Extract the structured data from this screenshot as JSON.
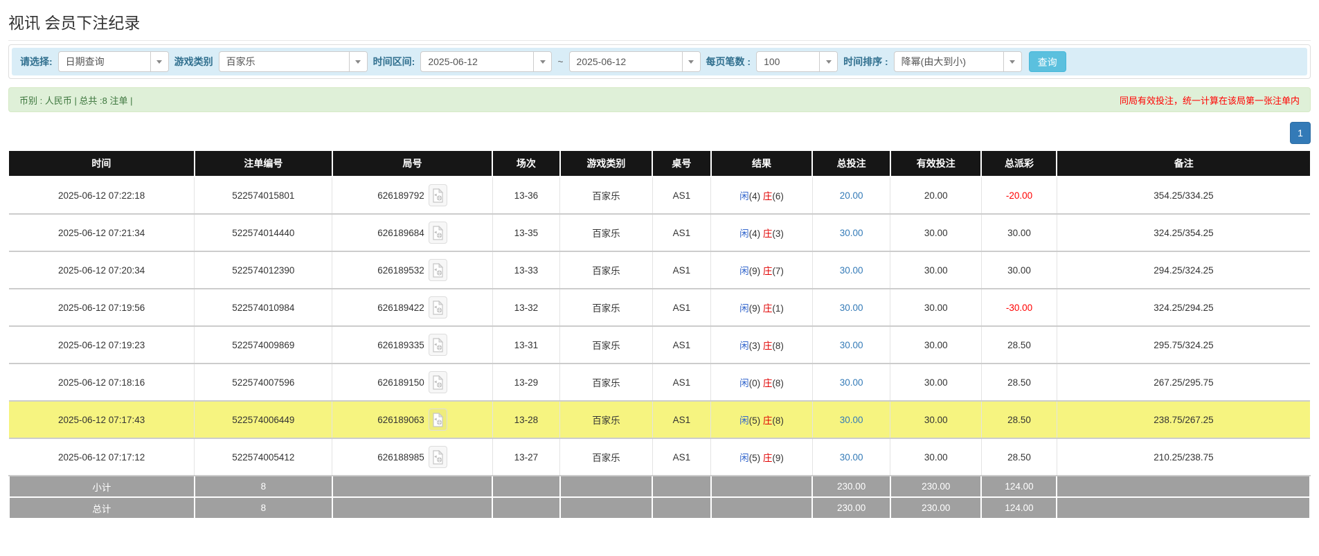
{
  "page": {
    "title": "视讯 会员下注纪录"
  },
  "filters": {
    "select_label": "请选择:",
    "select_value": "日期查询",
    "game_type_label": "游戏类别",
    "game_type_value": "百家乐",
    "date_range_label": "时间区间:",
    "date_from": "2025-06-12",
    "date_separator": "~",
    "date_to": "2025-06-12",
    "per_page_label": "每页笔数 :",
    "per_page_value": "100",
    "sort_label": "时间排序 :",
    "sort_value": "降幂(由大到小)",
    "search_button": "查询"
  },
  "summary": {
    "left_text": "币别 : 人民币 | 总共 :8 注单 |",
    "right_notice": "同局有效投注，统一计算在该局第一张注单内"
  },
  "pagination": {
    "pages": [
      "1"
    ]
  },
  "icons": {
    "select_caret": "chevron-down-icon",
    "round_video": "video-record-icon"
  },
  "colors": {
    "header_bg": "#161616",
    "highlight_row": "#f6f480",
    "footer_bg": "#a0a0a0",
    "link_blue": "#337ab7",
    "negative_red": "#ff0000",
    "player_blue": "#3366cc",
    "banker_red": "#e00000",
    "search_btn": "#5bc0de",
    "filter_bar_bg": "#d9edf7",
    "alert_bg": "#dff0d8"
  },
  "table": {
    "headers": [
      "时间",
      "注单编号",
      "局号",
      "场次",
      "游戏类别",
      "桌号",
      "结果",
      "总投注",
      "有效投注",
      "总派彩",
      "备注"
    ],
    "rows": [
      {
        "time": "2025-06-12 07:22:18",
        "bet_id": "522574015801",
        "round_id": "626189792",
        "session": "13-36",
        "game": "百家乐",
        "table_no": "AS1",
        "player_label": "闲",
        "player_score": "(4)",
        "banker_label": "庄",
        "banker_score": "(6)",
        "total_bet": "20.00",
        "valid_bet": "20.00",
        "payout": "-20.00",
        "remark": "354.25/334.25",
        "highlight": false
      },
      {
        "time": "2025-06-12 07:21:34",
        "bet_id": "522574014440",
        "round_id": "626189684",
        "session": "13-35",
        "game": "百家乐",
        "table_no": "AS1",
        "player_label": "闲",
        "player_score": "(4)",
        "banker_label": "庄",
        "banker_score": "(3)",
        "total_bet": "30.00",
        "valid_bet": "30.00",
        "payout": "30.00",
        "remark": "324.25/354.25",
        "highlight": false
      },
      {
        "time": "2025-06-12 07:20:34",
        "bet_id": "522574012390",
        "round_id": "626189532",
        "session": "13-33",
        "game": "百家乐",
        "table_no": "AS1",
        "player_label": "闲",
        "player_score": "(9)",
        "banker_label": "庄",
        "banker_score": "(7)",
        "total_bet": "30.00",
        "valid_bet": "30.00",
        "payout": "30.00",
        "remark": "294.25/324.25",
        "highlight": false
      },
      {
        "time": "2025-06-12 07:19:56",
        "bet_id": "522574010984",
        "round_id": "626189422",
        "session": "13-32",
        "game": "百家乐",
        "table_no": "AS1",
        "player_label": "闲",
        "player_score": "(9)",
        "banker_label": "庄",
        "banker_score": "(1)",
        "total_bet": "30.00",
        "valid_bet": "30.00",
        "payout": "-30.00",
        "remark": "324.25/294.25",
        "highlight": false
      },
      {
        "time": "2025-06-12 07:19:23",
        "bet_id": "522574009869",
        "round_id": "626189335",
        "session": "13-31",
        "game": "百家乐",
        "table_no": "AS1",
        "player_label": "闲",
        "player_score": "(3)",
        "banker_label": "庄",
        "banker_score": "(8)",
        "total_bet": "30.00",
        "valid_bet": "30.00",
        "payout": "28.50",
        "remark": "295.75/324.25",
        "highlight": false
      },
      {
        "time": "2025-06-12 07:18:16",
        "bet_id": "522574007596",
        "round_id": "626189150",
        "session": "13-29",
        "game": "百家乐",
        "table_no": "AS1",
        "player_label": "闲",
        "player_score": "(0)",
        "banker_label": "庄",
        "banker_score": "(8)",
        "total_bet": "30.00",
        "valid_bet": "30.00",
        "payout": "28.50",
        "remark": "267.25/295.75",
        "highlight": false
      },
      {
        "time": "2025-06-12 07:17:43",
        "bet_id": "522574006449",
        "round_id": "626189063",
        "session": "13-28",
        "game": "百家乐",
        "table_no": "AS1",
        "player_label": "闲",
        "player_score": "(5)",
        "banker_label": "庄",
        "banker_score": "(8)",
        "total_bet": "30.00",
        "valid_bet": "30.00",
        "payout": "28.50",
        "remark": "238.75/267.25",
        "highlight": true
      },
      {
        "time": "2025-06-12 07:17:12",
        "bet_id": "522574005412",
        "round_id": "626188985",
        "session": "13-27",
        "game": "百家乐",
        "table_no": "AS1",
        "player_label": "闲",
        "player_score": "(5)",
        "banker_label": "庄",
        "banker_score": "(9)",
        "total_bet": "30.00",
        "valid_bet": "30.00",
        "payout": "28.50",
        "remark": "210.25/238.75",
        "highlight": false
      }
    ],
    "footer": [
      {
        "label": "小计",
        "count": "8",
        "total_bet": "230.00",
        "valid_bet": "230.00",
        "payout": "124.00"
      },
      {
        "label": "总计",
        "count": "8",
        "total_bet": "230.00",
        "valid_bet": "230.00",
        "payout": "124.00"
      }
    ]
  }
}
